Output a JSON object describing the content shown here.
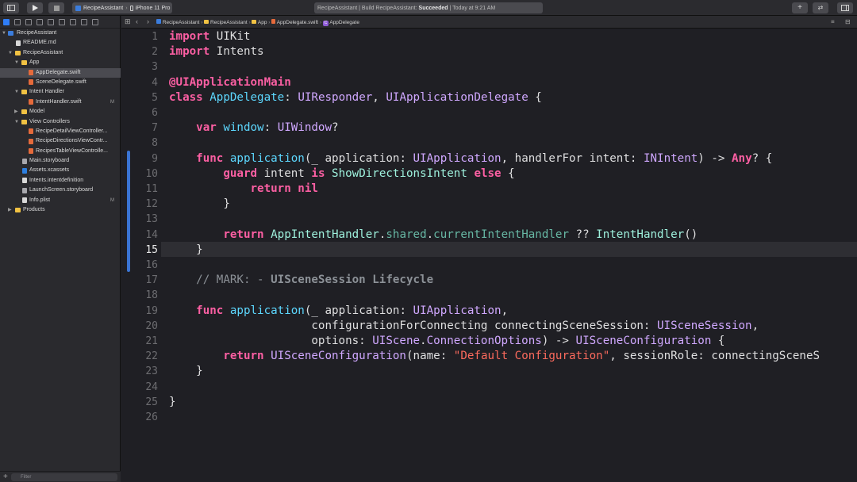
{
  "toolbar": {
    "scheme_target": "RecipeAssistant",
    "scheme_device": "iPhone 11 Pro",
    "activity_project": "RecipeAssistant | Build RecipeAssistant:",
    "activity_status": "Succeeded",
    "activity_time": "| Today at 9:21 AM"
  },
  "navigator": {
    "items": [
      {
        "label": "RecipeAssistant",
        "badge": ""
      },
      {
        "label": "README.md",
        "badge": ""
      },
      {
        "label": "RecipeAssistant",
        "badge": ""
      },
      {
        "label": "App",
        "badge": ""
      },
      {
        "label": "AppDelegate.swift",
        "badge": ""
      },
      {
        "label": "SceneDelegate.swift",
        "badge": ""
      },
      {
        "label": "Intent Handler",
        "badge": ""
      },
      {
        "label": "IntentHandler.swift",
        "badge": "M"
      },
      {
        "label": "Model",
        "badge": ""
      },
      {
        "label": "View Controllers",
        "badge": ""
      },
      {
        "label": "RecipeDetailViewController...",
        "badge": ""
      },
      {
        "label": "RecipeDirectionsViewContr...",
        "badge": ""
      },
      {
        "label": "RecipesTableViewControlle...",
        "badge": ""
      },
      {
        "label": "Main.storyboard",
        "badge": ""
      },
      {
        "label": "Assets.xcassets",
        "badge": ""
      },
      {
        "label": "Intents.intentdefinition",
        "badge": ""
      },
      {
        "label": "LaunchScreen.storyboard",
        "badge": ""
      },
      {
        "label": "Info.plist",
        "badge": "M"
      },
      {
        "label": "Products",
        "badge": ""
      }
    ],
    "filter_placeholder": "Filter"
  },
  "jumpbar": {
    "crumbs": [
      "RecipeAssistant",
      "RecipeAssistant",
      "App",
      "AppDelegate.swift",
      "AppDelegate"
    ]
  },
  "editor": {
    "current_line": 15,
    "lines": [
      {
        "num": "1"
      },
      {
        "num": "2"
      },
      {
        "num": "3"
      },
      {
        "num": "4"
      },
      {
        "num": "5"
      },
      {
        "num": "6"
      },
      {
        "num": "7"
      },
      {
        "num": "8"
      },
      {
        "num": "9"
      },
      {
        "num": "10"
      },
      {
        "num": "11"
      },
      {
        "num": "12"
      },
      {
        "num": "13"
      },
      {
        "num": "14"
      },
      {
        "num": "15"
      },
      {
        "num": "16"
      },
      {
        "num": "17"
      },
      {
        "num": "18"
      },
      {
        "num": "19"
      },
      {
        "num": "20"
      },
      {
        "num": "21"
      },
      {
        "num": "22"
      },
      {
        "num": "23"
      },
      {
        "num": "24"
      },
      {
        "num": "25"
      },
      {
        "num": "26"
      }
    ],
    "tokens": {
      "import_kw": "import",
      "uikit": "UIKit",
      "intents": "Intents",
      "uiapp_main": "@UIApplicationMain",
      "class_kw": "class",
      "appdelegate": "AppDelegate",
      "uiresponder": "UIResponder",
      "uiappdelegate": "UIApplicationDelegate",
      "var_kw": "var",
      "window": "window",
      "uiwindow": "UIWindow",
      "func_kw": "func",
      "application": "application",
      "uiapplication": "UIApplication",
      "inintent": "INIntent",
      "any": "Any",
      "guard_kw": "guard",
      "is_kw": "is",
      "showdirections": "ShowDirectionsIntent",
      "else_kw": "else",
      "return_kw": "return",
      "nil_kw": "nil",
      "appintenthandler": "AppIntentHandler",
      "shared": "shared",
      "currentintenthandler": "currentIntentHandler",
      "intenthandler": "IntentHandler",
      "mark_comment": "// MARK: - ",
      "mark_title": "UISceneSession Lifecycle",
      "uiscenesession": "UISceneSession",
      "uiscene": "UIScene",
      "connectionoptions": "ConnectionOptions",
      "uisceneconfiguration": "UISceneConfiguration",
      "default_config": "\"Default Configuration\"",
      "l9_a": "(_ application: ",
      "l9_b": ", handlerFor intent: ",
      "l9_c": ") -> ",
      "l9_d": "? {",
      "l10_a": " intent ",
      "l10_b": " {",
      "l14_a": ".",
      "l14_b": " ?? ",
      "l14_c": "()",
      "l20_a": "configurationForConnecting connectingSceneSession: ",
      "l20_b": ",",
      "l21_a": "options: ",
      "l22_a": "(name: ",
      "l22_b": ", sessionRole: connectingSceneS"
    }
  }
}
